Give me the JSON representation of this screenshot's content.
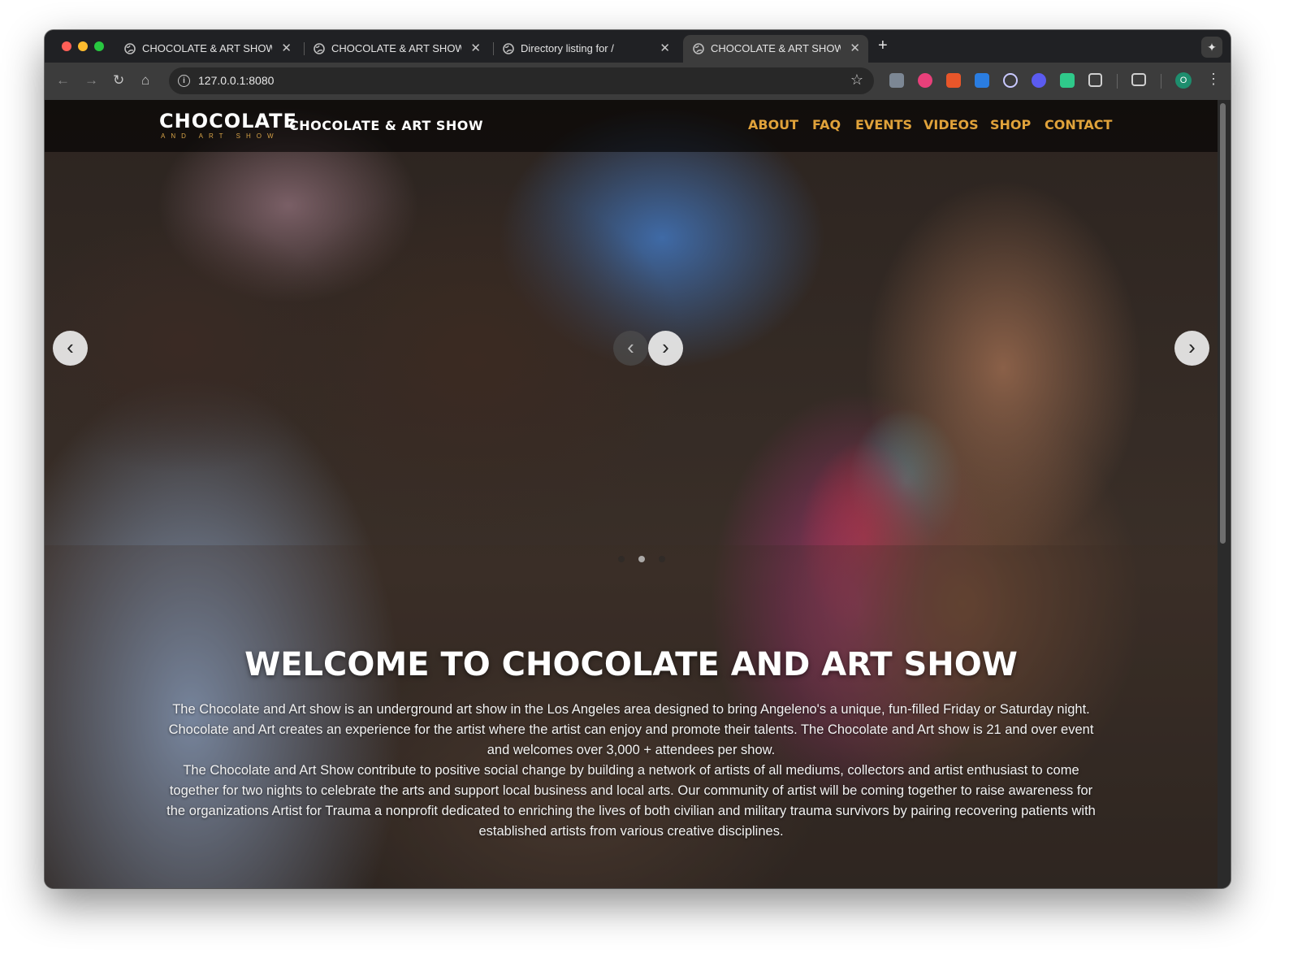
{
  "browser": {
    "tabs": [
      {
        "title": "CHOCOLATE & ART SHOW",
        "active": false
      },
      {
        "title": "CHOCOLATE & ART SHOW",
        "active": false
      },
      {
        "title": "Directory listing for /",
        "active": false
      },
      {
        "title": "CHOCOLATE & ART SHOW",
        "active": true
      }
    ],
    "new_tab_label": "+",
    "close_glyph": "✕",
    "address": "127.0.0.1:8080"
  },
  "site": {
    "logo_main": "CHOCOLATE",
    "logo_sub": "AND ART SHOW",
    "title": "CHOCOLATE & ART SHOW",
    "nav": [
      "ABOUT",
      "FAQ",
      "EVENTS",
      "VIDEOS",
      "SHOP",
      "CONTACT"
    ],
    "accent_color": "#e0a23a",
    "logo_sub_color": "#d6a247"
  },
  "hero": {
    "heading": "WELCOME TO CHOCOLATE AND ART SHOW",
    "paragraph1": "The Chocolate and Art show is an underground art show in the Los Angeles area designed to bring Angeleno's a unique, fun-filled Friday or Saturday night. Chocolate and Art creates an experience for the artist where the artist can enjoy and promote their talents. The Chocolate and Art show is 21 and over event and welcomes over 3,000 + attendees per show.",
    "paragraph2": "The Chocolate and Art Show contribute to positive social change by building a network of artists of all mediums, collectors and artist enthusiast to come together for two nights to celebrate the arts and support local business and local arts. Our community of artist will be coming together to raise awareness for the organizations Artist for Trauma a nonprofit dedicated to enriching the lives of both civilian and military trauma survivors by pairing recovering patients with established artists from various creative disciplines.",
    "carousel_dots": 3,
    "active_dot": 2
  },
  "icons": {
    "prev_arrow": "‹",
    "next_arrow": "›",
    "back": "←",
    "forward": "→",
    "reload": "↻",
    "home": "⌂",
    "star": "☆",
    "menu": "⋮",
    "profile_initial": "O",
    "ai": "✦"
  }
}
